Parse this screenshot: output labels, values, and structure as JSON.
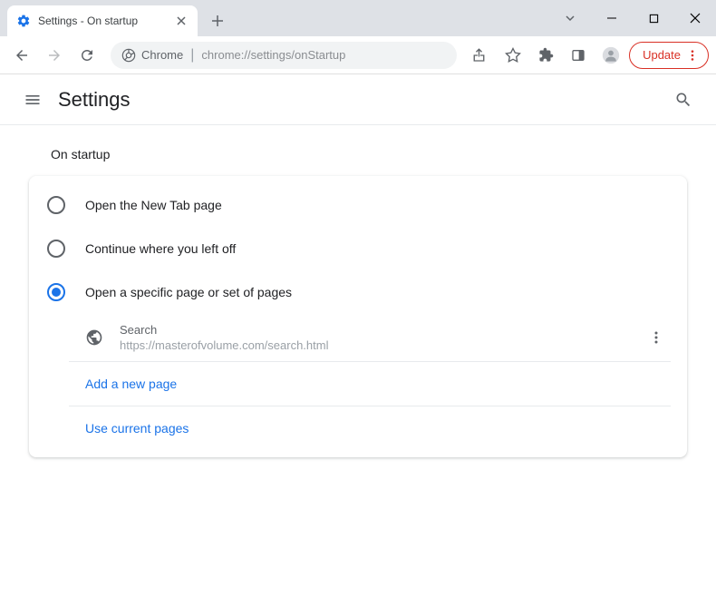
{
  "window": {
    "tab_title": "Settings - On startup"
  },
  "toolbar": {
    "omnibox_chip": "Chrome",
    "omnibox_url": "chrome://settings/onStartup",
    "update_label": "Update"
  },
  "header": {
    "title": "Settings"
  },
  "section": {
    "title": "On startup",
    "options": {
      "new_tab": "Open the New Tab page",
      "continue": "Continue where you left off",
      "specific": "Open a specific page or set of pages"
    },
    "pages": [
      {
        "name": "Search",
        "url": "https://masterofvolume.com/search.html"
      }
    ],
    "add_page": "Add a new page",
    "use_current": "Use current pages"
  }
}
